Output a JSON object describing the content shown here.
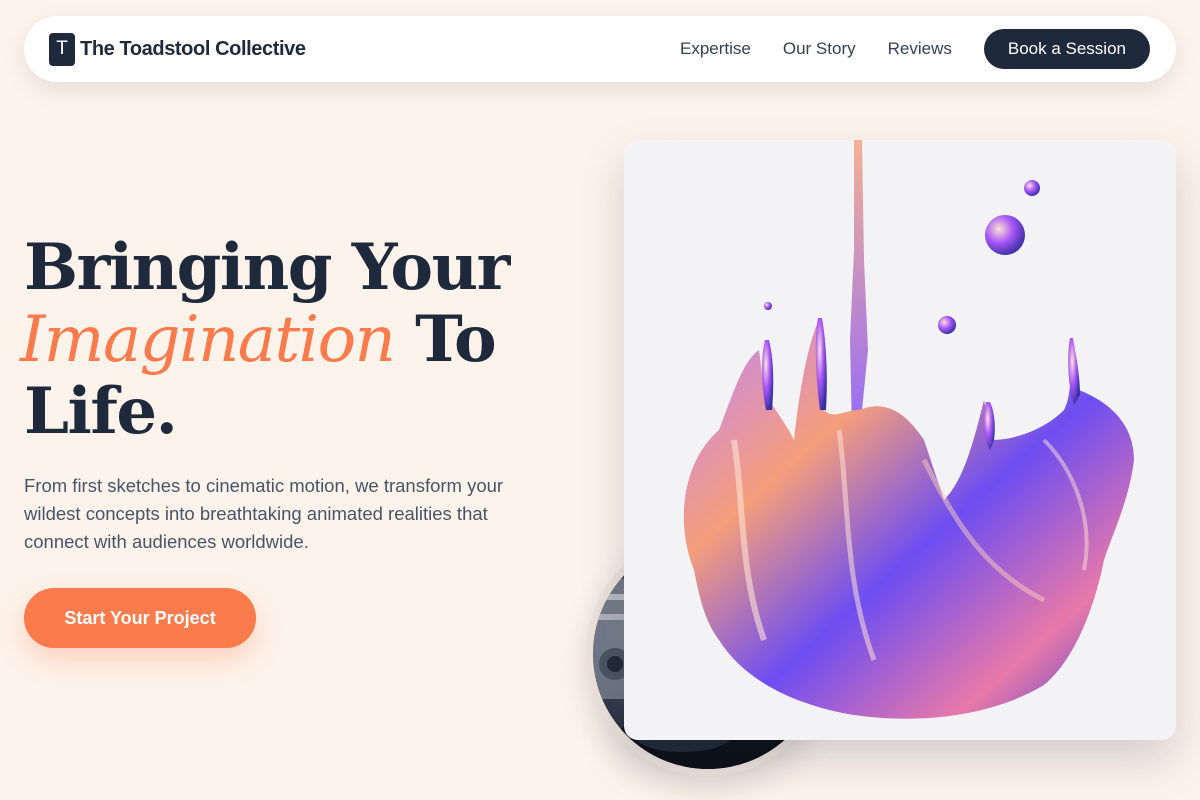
{
  "header": {
    "logo_letter": "T",
    "brand_name": "The Toadstool Collective",
    "nav": [
      {
        "label": "Expertise"
      },
      {
        "label": "Our Story"
      },
      {
        "label": "Reviews"
      }
    ],
    "cta_label": "Book a Session"
  },
  "hero": {
    "title_line1": "Bringing Your",
    "title_accent": "Imagination",
    "title_line2_rest": " To",
    "title_line3": "Life.",
    "description": "From first sketches to cinematic motion, we transform your wildest concepts into breathtaking animated realities that connect with audiences worldwide.",
    "primary_button": "Start Your Project"
  },
  "colors": {
    "background": "#fdf3eb",
    "primary_dark": "#1e293b",
    "accent": "#fb7b4c"
  }
}
